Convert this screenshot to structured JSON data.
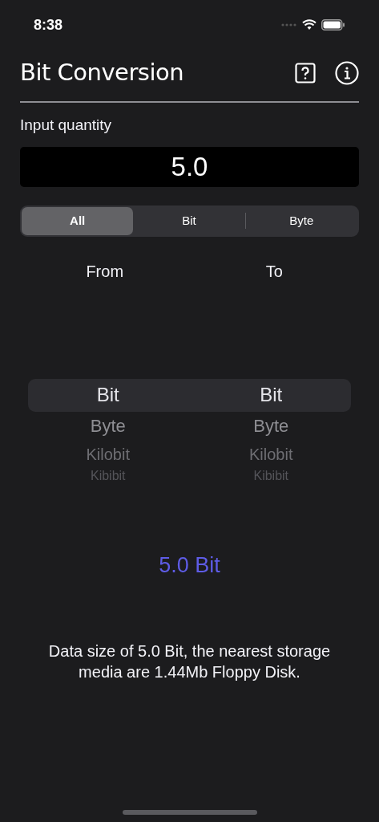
{
  "status_bar": {
    "time": "8:38"
  },
  "header": {
    "title": "Bit Conversion"
  },
  "input": {
    "label": "Input quantity",
    "value": "5.0"
  },
  "segments": [
    {
      "label": "All",
      "selected": true
    },
    {
      "label": "Bit",
      "selected": false
    },
    {
      "label": "Byte",
      "selected": false
    }
  ],
  "picker_labels": [
    "From",
    "To"
  ],
  "pickers": [
    {
      "items": [
        {
          "label": "Bit",
          "selected": true
        },
        {
          "label": "Byte",
          "selected": false
        },
        {
          "label": "Kilobit",
          "selected": false
        },
        {
          "label": "Kibibit",
          "selected": false
        }
      ]
    },
    {
      "items": [
        {
          "label": "Bit",
          "selected": true
        },
        {
          "label": "Byte",
          "selected": false
        },
        {
          "label": "Kilobit",
          "selected": false
        },
        {
          "label": "Kibibit",
          "selected": false
        }
      ]
    }
  ],
  "result": "5.0 Bit",
  "description": "Data size of 5.0 Bit, the nearest storage media are 1.44Mb Floppy Disk."
}
